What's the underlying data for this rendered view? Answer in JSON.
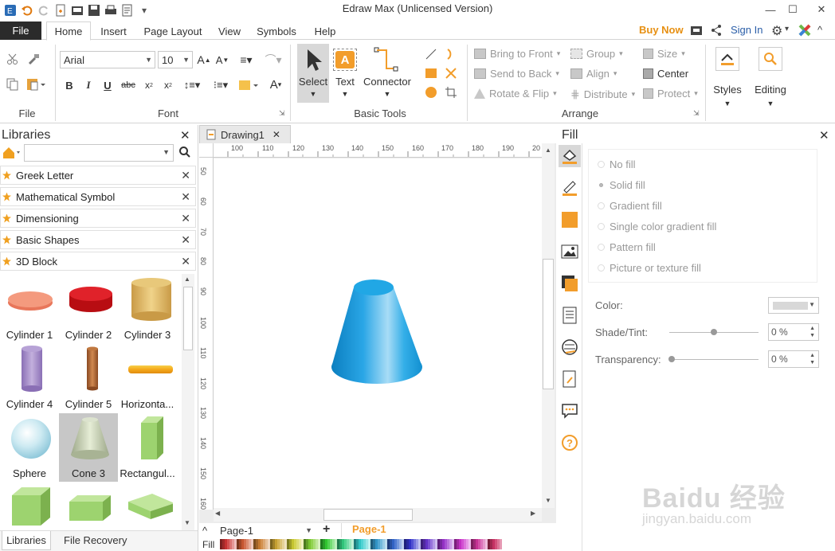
{
  "app": {
    "title": "Edraw Max (Unlicensed Version)"
  },
  "ribbon_tabs": {
    "file": "File",
    "items": [
      "Home",
      "Insert",
      "Page Layout",
      "View",
      "Symbols",
      "Help"
    ],
    "buy_now": "Buy Now",
    "sign_in": "Sign In"
  },
  "font_group": {
    "font_name": "Arial",
    "font_size": "10",
    "label": "Font"
  },
  "file_group": {
    "label": "File"
  },
  "basic_tools": {
    "select": "Select",
    "text": "Text",
    "connector": "Connector",
    "label": "Basic Tools"
  },
  "arrange": {
    "bring_to_front": "Bring to Front",
    "send_to_back": "Send to Back",
    "rotate_flip": "Rotate & Flip",
    "group": "Group",
    "align": "Align",
    "distribute": "Distribute",
    "size": "Size",
    "center": "Center",
    "protect": "Protect",
    "label": "Arrange"
  },
  "styles": {
    "label": "Styles"
  },
  "editing": {
    "label": "Editing"
  },
  "libraries": {
    "title": "Libraries",
    "search_value": "",
    "list": [
      "Greek Letter",
      "Mathematical Symbol",
      "Dimensioning",
      "Basic Shapes",
      "3D Block"
    ],
    "shapes": [
      "Cylinder 1",
      "Cylinder 2",
      "Cylinder 3",
      "Cylinder 4",
      "Cylinder 5",
      "Horizonta...",
      "Sphere",
      "Cone 3",
      "Rectangul...",
      "",
      "",
      ""
    ],
    "bottom_tabs": [
      "Libraries",
      "File Recovery"
    ]
  },
  "document": {
    "tab": "Drawing1",
    "h_ruler": [
      "100",
      "110",
      "120",
      "130",
      "140",
      "150",
      "160",
      "170",
      "180",
      "190",
      "20"
    ],
    "v_ruler": [
      "50",
      "60",
      "70",
      "80",
      "90",
      "100",
      "110",
      "120",
      "130",
      "140",
      "150",
      "160"
    ],
    "page_select": "Page-1",
    "active_page": "Page-1",
    "fill_label": "Fill"
  },
  "fill_panel": {
    "title": "Fill",
    "options": [
      "No fill",
      "Solid fill",
      "Gradient fill",
      "Single color gradient fill",
      "Pattern fill",
      "Picture or texture fill"
    ],
    "selected": "Solid fill",
    "color_label": "Color:",
    "shade_label": "Shade/Tint:",
    "shade_value": "0 %",
    "transparency_label": "Transparency:",
    "transparency_value": "0 %"
  },
  "colors": {
    "accent_orange": "#e79012",
    "cone_blue": "#1e9ad6",
    "file_tab": "#2b2b2b",
    "link_blue": "#2a5ea8"
  },
  "watermark": {
    "text1": "Baidu 经验",
    "text2": "jingyan.baidu.com"
  }
}
